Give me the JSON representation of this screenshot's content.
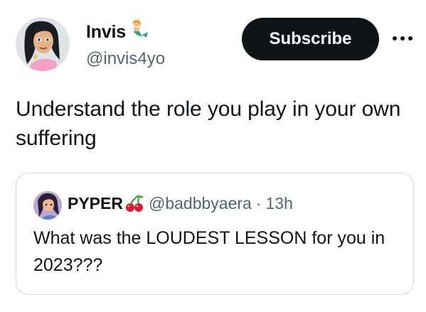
{
  "author": {
    "display_name": "Invis",
    "name_emoji_icon": "mermaid-icon",
    "handle": "@invis4yo",
    "avatar_icon": "cartoon-avatar"
  },
  "actions": {
    "subscribe_label": "Subscribe",
    "more_icon": "ellipsis-icon"
  },
  "tweet": {
    "text": "Understand the role you play in your own suffering"
  },
  "quoted_tweet": {
    "display_name": "PYPER",
    "name_emoji_icon": "cherries-icon",
    "handle": "@badbbyaera",
    "separator": "·",
    "time": "13h",
    "text": "What was the LOUDEST LESSON for you in 2023???"
  },
  "colors": {
    "text_primary": "#0f1419",
    "text_secondary": "#536471",
    "button_bg": "#0f1419",
    "border": "#cfd9de"
  }
}
